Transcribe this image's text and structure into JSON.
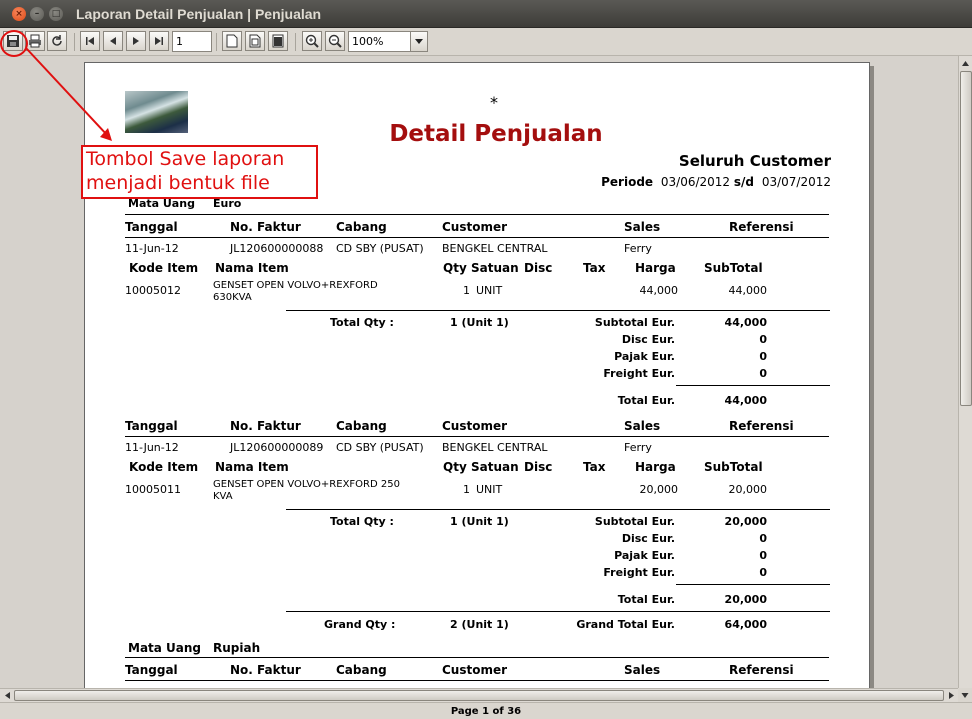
{
  "window": {
    "title": "Laporan Detail Penjualan | Penjualan",
    "close": "×",
    "minimize": "–",
    "maximize": "□"
  },
  "toolbar": {
    "page_number": "1",
    "zoom": "100%"
  },
  "report": {
    "star": "*",
    "title": "Detail Penjualan",
    "customer_scope": "Seluruh Customer",
    "periode_label": "Periode",
    "date_from": "03/06/2012",
    "sd_label": "s/d",
    "date_to": "03/07/2012",
    "currency_label": "Mata Uang",
    "currency_euro": "Euro",
    "currency_rupiah": "Rupiah",
    "headers": {
      "tanggal": "Tanggal",
      "no_faktur": "No. Faktur",
      "cabang": "Cabang",
      "customer": "Customer",
      "sales": "Sales",
      "referensi": "Referensi",
      "kode_item": "Kode Item",
      "nama_item": "Nama Item",
      "qty": "Qty",
      "satuan": "Satuan",
      "disc": "Disc",
      "tax": "Tax",
      "harga": "Harga",
      "subtotal": "SubTotal"
    },
    "labels": {
      "total_qty": "Total Qty :",
      "subtotal": "Subtotal Eur.",
      "disc": "Disc Eur.",
      "pajak": "Pajak Eur.",
      "freight": "Freight Eur.",
      "total": "Total Eur.",
      "grand_qty": "Grand Qty :",
      "grand_total": "Grand Total Eur."
    },
    "invoices": [
      {
        "tanggal": "11-Jun-12",
        "no_faktur": "JL120600000088",
        "cabang": "CD SBY (PUSAT)",
        "customer": "BENGKEL CENTRAL",
        "sales": "Ferry",
        "item": {
          "kode": "10005012",
          "nama_line1": "GENSET OPEN VOLVO+REXFORD",
          "nama_line2": "630KVA",
          "qty": "1",
          "satuan": "UNIT",
          "harga": "44,000",
          "subtotal": "44,000"
        },
        "total_qty": "1 (Unit 1)",
        "subtotal": "44,000",
        "disc": "0",
        "pajak": "0",
        "freight": "0",
        "total": "44,000"
      },
      {
        "tanggal": "11-Jun-12",
        "no_faktur": "JL120600000089",
        "cabang": "CD SBY (PUSAT)",
        "customer": "BENGKEL CENTRAL",
        "sales": "Ferry",
        "item": {
          "kode": "10005011",
          "nama_line1": "GENSET OPEN VOLVO+REXFORD 250",
          "nama_line2": "KVA",
          "qty": "1",
          "satuan": "UNIT",
          "harga": "20,000",
          "subtotal": "20,000"
        },
        "total_qty": "1 (Unit 1)",
        "subtotal": "20,000",
        "disc": "0",
        "pajak": "0",
        "freight": "0",
        "total": "20,000"
      }
    ],
    "grand_qty": "2 (Unit 1)",
    "grand_total": "64,000"
  },
  "annotation": {
    "line1": "Tombol Save laporan",
    "line2": "menjadi bentuk file",
    "color": "#e01010"
  },
  "status": {
    "page": "Page 1 of 36"
  },
  "colors": {
    "title": "#a40e0e",
    "titlebar": "#3d3c38"
  }
}
